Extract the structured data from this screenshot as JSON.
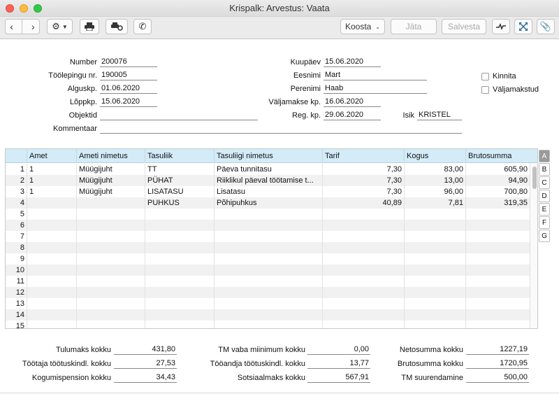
{
  "window": {
    "title": "Krispalk: Arvestus: Vaata"
  },
  "toolbar": {
    "select_value": "Koosta",
    "save_disabled": "Jäta",
    "save2_disabled": "Salvesta"
  },
  "form": {
    "number": {
      "label": "Number",
      "value": "200076"
    },
    "contract": {
      "label": "Töölepingu nr.",
      "value": "190005"
    },
    "start": {
      "label": "Alguskp.",
      "value": "01.06.2020"
    },
    "end": {
      "label": "Lõppkp.",
      "value": "15.06.2020"
    },
    "objects": {
      "label": "Objektid",
      "value": ""
    },
    "comment": {
      "label": "Kommentaar",
      "value": ""
    },
    "date": {
      "label": "Kuupäev",
      "value": "15.06.2020"
    },
    "firstname": {
      "label": "Eesnimi",
      "value": "Mart"
    },
    "lastname": {
      "label": "Perenimi",
      "value": "Haab"
    },
    "paydate": {
      "label": "Väljamakse kp.",
      "value": "16.06.2020"
    },
    "regdate": {
      "label": "Reg. kp.",
      "value": "29.06.2020"
    },
    "person": {
      "label": "Isik",
      "value": "KRISTEL"
    },
    "approve": {
      "label": "Kinnita"
    },
    "paid": {
      "label": "Väljamakstud"
    }
  },
  "grid": {
    "headers": [
      "Amet",
      "Ameti nimetus",
      "Tasuliik",
      "Tasuliigi nimetus",
      "Tarif",
      "Kogus",
      "Brutosumma"
    ],
    "rows": [
      {
        "n": "1",
        "amet": "1",
        "ameti": "Müügijuht",
        "tasuliik": "TT",
        "nimetus": "Päeva tunnitasu",
        "tarif": "7,30",
        "kogus": "83,00",
        "bruto": "605,90"
      },
      {
        "n": "2",
        "amet": "1",
        "ameti": "Müügijuht",
        "tasuliik": "PÜHAT",
        "nimetus": "Riiklikul päeval töötamise t...",
        "tarif": "7,30",
        "kogus": "13,00",
        "bruto": "94,90"
      },
      {
        "n": "3",
        "amet": "1",
        "ameti": "Müügijuht",
        "tasuliik": "LISATASU",
        "nimetus": "Lisatasu",
        "tarif": "7,30",
        "kogus": "96,00",
        "bruto": "700,80"
      },
      {
        "n": "4",
        "amet": "",
        "ameti": "",
        "tasuliik": "PUHKUS",
        "nimetus": "Põhipuhkus",
        "tarif": "40,89",
        "kogus": "7,81",
        "bruto": "319,35"
      },
      {
        "n": "5"
      },
      {
        "n": "6"
      },
      {
        "n": "7"
      },
      {
        "n": "8"
      },
      {
        "n": "9"
      },
      {
        "n": "10"
      },
      {
        "n": "11"
      },
      {
        "n": "12"
      },
      {
        "n": "13"
      },
      {
        "n": "14"
      },
      {
        "n": "15"
      }
    ],
    "tabs": [
      "A",
      "B",
      "C",
      "D",
      "E",
      "F",
      "G"
    ]
  },
  "totals": {
    "tulumaks": {
      "label": "Tulumaks kokku",
      "value": "431,80"
    },
    "tootaja": {
      "label": "Töötaja töötuskindl. kokku",
      "value": "27,53"
    },
    "kogumis": {
      "label": "Kogumispension kokku",
      "value": "34,43"
    },
    "tmvaba": {
      "label": "TM vaba miinimum kokku",
      "value": "0,00"
    },
    "tooandja": {
      "label": "Tööandja töötuskindl. kokku",
      "value": "13,77"
    },
    "sots": {
      "label": "Sotsiaalmaks kokku",
      "value": "567,91"
    },
    "neto": {
      "label": "Netosumma kokku",
      "value": "1227,19"
    },
    "bruto": {
      "label": "Brutosumma kokku",
      "value": "1720,95"
    },
    "tmsuur": {
      "label": "TM suurendamine",
      "value": "500,00"
    }
  }
}
